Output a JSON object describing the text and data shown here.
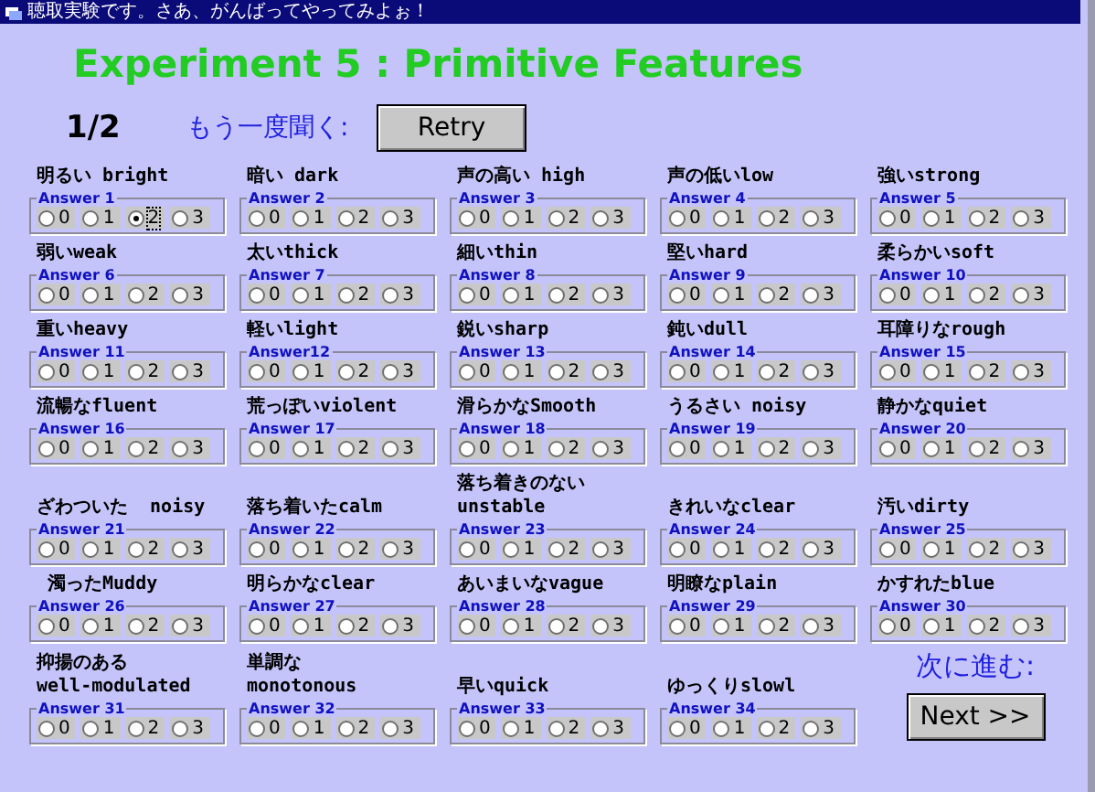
{
  "window": {
    "title": "聴取実験です。さあ、がんばってやってみよぉ！"
  },
  "heading": "Experiment 5 : Primitive Features",
  "progress": "1/2",
  "retry_label": "もう一度聞く:",
  "retry_button": "Retry",
  "items": [
    {
      "label": "明るい bright",
      "group": "Answer 1",
      "options": [
        {
          "label": "0",
          "selected": false
        },
        {
          "label": "1",
          "selected": false
        },
        {
          "label": "2",
          "selected": true
        },
        {
          "label": "3",
          "selected": false
        }
      ]
    },
    {
      "label": "暗い dark",
      "group": "Answer 2",
      "options": [
        {
          "label": "0",
          "selected": false
        },
        {
          "label": "1",
          "selected": false
        },
        {
          "label": "2",
          "selected": false
        },
        {
          "label": "3",
          "selected": false
        }
      ]
    },
    {
      "label": "声の高い high",
      "group": "Answer 3",
      "options": [
        {
          "label": "0",
          "selected": false
        },
        {
          "label": "1",
          "selected": false
        },
        {
          "label": "2",
          "selected": false
        },
        {
          "label": "3",
          "selected": false
        }
      ]
    },
    {
      "label": "声の低いlow",
      "group": "Answer 4",
      "options": [
        {
          "label": "0",
          "selected": false
        },
        {
          "label": "1",
          "selected": false
        },
        {
          "label": "2",
          "selected": false
        },
        {
          "label": "3",
          "selected": false
        }
      ]
    },
    {
      "label": "強いstrong",
      "group": "Answer 5",
      "options": [
        {
          "label": "0",
          "selected": false
        },
        {
          "label": "1",
          "selected": false
        },
        {
          "label": "2",
          "selected": false
        },
        {
          "label": "3",
          "selected": false
        }
      ]
    },
    {
      "label": "弱いweak",
      "group": "Answer 6",
      "options": [
        {
          "label": "0",
          "selected": false
        },
        {
          "label": "1",
          "selected": false
        },
        {
          "label": "2",
          "selected": false
        },
        {
          "label": "3",
          "selected": false
        }
      ]
    },
    {
      "label": "太いthick",
      "group": "Answer 7",
      "options": [
        {
          "label": "0",
          "selected": false
        },
        {
          "label": "1",
          "selected": false
        },
        {
          "label": "2",
          "selected": false
        },
        {
          "label": "3",
          "selected": false
        }
      ]
    },
    {
      "label": "細いthin",
      "group": "Answer 8",
      "options": [
        {
          "label": "0",
          "selected": false
        },
        {
          "label": "1",
          "selected": false
        },
        {
          "label": "2",
          "selected": false
        },
        {
          "label": "3",
          "selected": false
        }
      ]
    },
    {
      "label": "堅いhard",
      "group": "Answer 9",
      "options": [
        {
          "label": "0",
          "selected": false
        },
        {
          "label": "1",
          "selected": false
        },
        {
          "label": "2",
          "selected": false
        },
        {
          "label": "3",
          "selected": false
        }
      ]
    },
    {
      "label": "柔らかいsoft",
      "group": "Answer 10",
      "options": [
        {
          "label": "0",
          "selected": false
        },
        {
          "label": "1",
          "selected": false
        },
        {
          "label": "2",
          "selected": false
        },
        {
          "label": "3",
          "selected": false
        }
      ]
    },
    {
      "label": "重いheavy",
      "group": "Answer 11",
      "options": [
        {
          "label": "0",
          "selected": false
        },
        {
          "label": "1",
          "selected": false
        },
        {
          "label": "2",
          "selected": false
        },
        {
          "label": "3",
          "selected": false
        }
      ]
    },
    {
      "label": "軽いlight",
      "group": "Answer12",
      "options": [
        {
          "label": "0",
          "selected": false
        },
        {
          "label": "1",
          "selected": false
        },
        {
          "label": "2",
          "selected": false
        },
        {
          "label": "3",
          "selected": false
        }
      ]
    },
    {
      "label": "鋭いsharp",
      "group": "Answer 13",
      "options": [
        {
          "label": "0",
          "selected": false
        },
        {
          "label": "1",
          "selected": false
        },
        {
          "label": "2",
          "selected": false
        },
        {
          "label": "3",
          "selected": false
        }
      ]
    },
    {
      "label": "鈍いdull",
      "group": "Answer 14",
      "options": [
        {
          "label": "0",
          "selected": false
        },
        {
          "label": "1",
          "selected": false
        },
        {
          "label": "2",
          "selected": false
        },
        {
          "label": "3",
          "selected": false
        }
      ]
    },
    {
      "label": "耳障りなrough",
      "group": "Answer 15",
      "options": [
        {
          "label": "0",
          "selected": false
        },
        {
          "label": "1",
          "selected": false
        },
        {
          "label": "2",
          "selected": false
        },
        {
          "label": "3",
          "selected": false
        }
      ]
    },
    {
      "label": "流暢なfluent",
      "group": "Answer 16",
      "options": [
        {
          "label": "0",
          "selected": false
        },
        {
          "label": "1",
          "selected": false
        },
        {
          "label": "2",
          "selected": false
        },
        {
          "label": "3",
          "selected": false
        }
      ]
    },
    {
      "label": "荒っぽいviolent",
      "group": "Answer 17",
      "options": [
        {
          "label": "0",
          "selected": false
        },
        {
          "label": "1",
          "selected": false
        },
        {
          "label": "2",
          "selected": false
        },
        {
          "label": "3",
          "selected": false
        }
      ]
    },
    {
      "label": "滑らかなSmooth",
      "group": "Answer 18",
      "options": [
        {
          "label": "0",
          "selected": false
        },
        {
          "label": "1",
          "selected": false
        },
        {
          "label": "2",
          "selected": false
        },
        {
          "label": "3",
          "selected": false
        }
      ]
    },
    {
      "label": "うるさい noisy",
      "group": "Answer 19",
      "options": [
        {
          "label": "0",
          "selected": false
        },
        {
          "label": "1",
          "selected": false
        },
        {
          "label": "2",
          "selected": false
        },
        {
          "label": "3",
          "selected": false
        }
      ]
    },
    {
      "label": "静かなquiet",
      "group": "Answer 20",
      "options": [
        {
          "label": "0",
          "selected": false
        },
        {
          "label": "1",
          "selected": false
        },
        {
          "label": "2",
          "selected": false
        },
        {
          "label": "3",
          "selected": false
        }
      ]
    },
    {
      "label": "ざわついた  noisy",
      "group": "Answer 21",
      "options": [
        {
          "label": "0",
          "selected": false
        },
        {
          "label": "1",
          "selected": false
        },
        {
          "label": "2",
          "selected": false
        },
        {
          "label": "3",
          "selected": false
        }
      ]
    },
    {
      "label": "落ち着いたcalm",
      "group": "Answer 22",
      "options": [
        {
          "label": "0",
          "selected": false
        },
        {
          "label": "1",
          "selected": false
        },
        {
          "label": "2",
          "selected": false
        },
        {
          "label": "3",
          "selected": false
        }
      ]
    },
    {
      "label": "落ち着きのない\nunstable",
      "group": "Answer 23",
      "options": [
        {
          "label": "0",
          "selected": false
        },
        {
          "label": "1",
          "selected": false
        },
        {
          "label": "2",
          "selected": false
        },
        {
          "label": "3",
          "selected": false
        }
      ]
    },
    {
      "label": "きれいなclear",
      "group": "Answer 24",
      "options": [
        {
          "label": "0",
          "selected": false
        },
        {
          "label": "1",
          "selected": false
        },
        {
          "label": "2",
          "selected": false
        },
        {
          "label": "3",
          "selected": false
        }
      ]
    },
    {
      "label": "汚いdirty",
      "group": "Answer 25",
      "options": [
        {
          "label": "0",
          "selected": false
        },
        {
          "label": "1",
          "selected": false
        },
        {
          "label": "2",
          "selected": false
        },
        {
          "label": "3",
          "selected": false
        }
      ]
    },
    {
      "label": " 濁ったMuddy",
      "group": "Answer 26",
      "options": [
        {
          "label": "0",
          "selected": false
        },
        {
          "label": "1",
          "selected": false
        },
        {
          "label": "2",
          "selected": false
        },
        {
          "label": "3",
          "selected": false
        }
      ]
    },
    {
      "label": "明らかなclear",
      "group": "Answer 27",
      "options": [
        {
          "label": "0",
          "selected": false
        },
        {
          "label": "1",
          "selected": false
        },
        {
          "label": "2",
          "selected": false
        },
        {
          "label": "3",
          "selected": false
        }
      ]
    },
    {
      "label": "あいまいなvague",
      "group": "Answer 28",
      "options": [
        {
          "label": "0",
          "selected": false
        },
        {
          "label": "1",
          "selected": false
        },
        {
          "label": "2",
          "selected": false
        },
        {
          "label": "3",
          "selected": false
        }
      ]
    },
    {
      "label": "明瞭なplain",
      "group": "Answer 29",
      "options": [
        {
          "label": "0",
          "selected": false
        },
        {
          "label": "1",
          "selected": false
        },
        {
          "label": "2",
          "selected": false
        },
        {
          "label": "3",
          "selected": false
        }
      ]
    },
    {
      "label": "かすれたblue",
      "group": "Answer 30",
      "options": [
        {
          "label": "0",
          "selected": false
        },
        {
          "label": "1",
          "selected": false
        },
        {
          "label": "2",
          "selected": false
        },
        {
          "label": "3",
          "selected": false
        }
      ]
    },
    {
      "label": "抑揚のある\nwell-modulated",
      "group": "Answer 31",
      "options": [
        {
          "label": "0",
          "selected": false
        },
        {
          "label": "1",
          "selected": false
        },
        {
          "label": "2",
          "selected": false
        },
        {
          "label": "3",
          "selected": false
        }
      ]
    },
    {
      "label": "単調な\nmonotonous",
      "group": "Answer 32",
      "options": [
        {
          "label": "0",
          "selected": false
        },
        {
          "label": "1",
          "selected": false
        },
        {
          "label": "2",
          "selected": false
        },
        {
          "label": "3",
          "selected": false
        }
      ]
    },
    {
      "label": "早いquick",
      "group": "Answer 33",
      "options": [
        {
          "label": "0",
          "selected": false
        },
        {
          "label": "1",
          "selected": false
        },
        {
          "label": "2",
          "selected": false
        },
        {
          "label": "3",
          "selected": false
        }
      ]
    },
    {
      "label": "ゆっくりslowl",
      "group": "Answer 34",
      "options": [
        {
          "label": "0",
          "selected": false
        },
        {
          "label": "1",
          "selected": false
        },
        {
          "label": "2",
          "selected": false
        },
        {
          "label": "3",
          "selected": false
        }
      ]
    }
  ],
  "next_label": "次に進む:",
  "next_button": "Next >>"
}
